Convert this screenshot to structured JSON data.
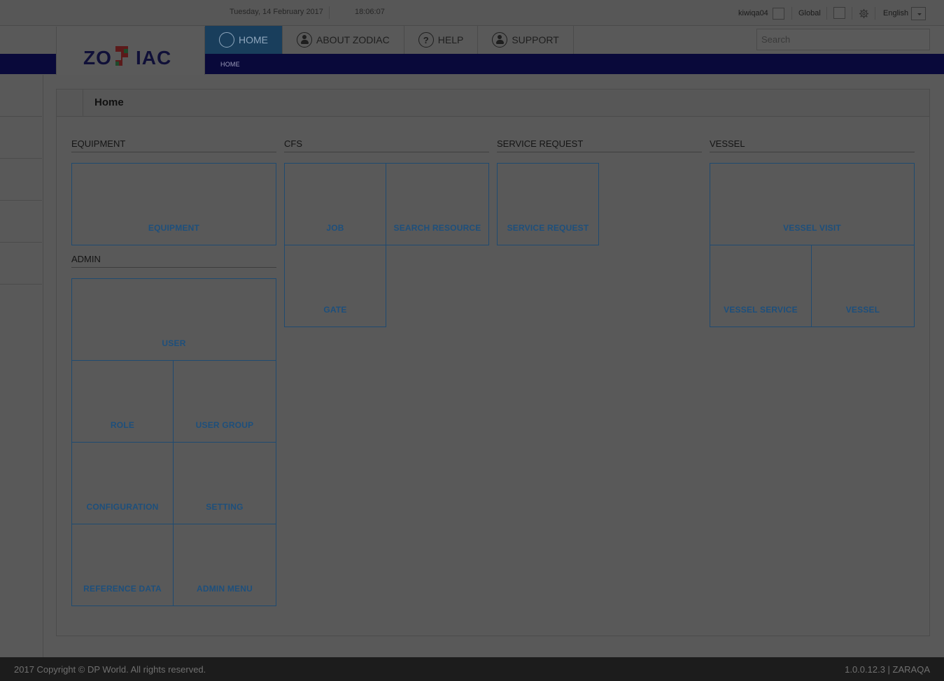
{
  "topbar": {
    "date": "Tuesday, 14 February 2017",
    "time": "18:06:07",
    "user": "kiwiqa04",
    "scope": "Global",
    "language": "English"
  },
  "nav": {
    "tabs": [
      {
        "label": "HOME",
        "icon": "home-circle-icon",
        "active": true
      },
      {
        "label": "ABOUT ZODIAC",
        "icon": "people-icon",
        "active": false
      },
      {
        "label": "HELP",
        "icon": "question-icon",
        "active": false
      },
      {
        "label": "SUPPORT",
        "icon": "support-person-icon",
        "active": false
      }
    ],
    "breadcrumb": "HOME",
    "search_placeholder": "Search"
  },
  "logo": {
    "text": "ZODIAC"
  },
  "page": {
    "title": "Home"
  },
  "sections": {
    "equipment": {
      "title": "EQUIPMENT",
      "tiles": [
        "EQUIPMENT"
      ]
    },
    "admin": {
      "title": "ADMIN",
      "tiles": [
        "USER",
        "ROLE",
        "USER GROUP",
        "CONFIGURATION",
        "SETTING",
        "REFERENCE DATA",
        "ADMIN MENU"
      ]
    },
    "cfs": {
      "title": "CFS",
      "tiles": [
        "JOB",
        "SEARCH RESOURCE",
        "GATE"
      ]
    },
    "service_request": {
      "title": "SERVICE REQUEST",
      "tiles": [
        "SERVICE REQUEST"
      ]
    },
    "vessel": {
      "title": "VESSEL",
      "tiles": [
        "VESSEL VISIT",
        "VESSEL SERVICE",
        "VESSEL"
      ]
    }
  },
  "footer": {
    "copyright": "2017 Copyright © DP World. All rights reserved.",
    "version": "1.0.0.12.3 | ZARAQA"
  },
  "colors": {
    "navy": "#09093a",
    "active_tab": "#193e5c",
    "tile_text": "#1d4f7c",
    "tile_border": "#1f4a70",
    "footer": "#1c1c1c"
  }
}
